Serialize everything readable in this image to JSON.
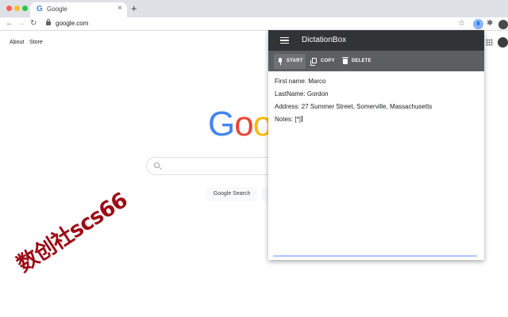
{
  "browser": {
    "tab_favicon": "G",
    "tab_title": "Google",
    "tab_close": "×",
    "new_tab": "+",
    "back": "←",
    "forward": "→",
    "reload": "↻",
    "url": "google.com",
    "star": "☆",
    "puzzle": "✱",
    "icons": [
      "back-icon",
      "forward-icon",
      "reload-icon",
      "lock-icon",
      "star-icon",
      "microphone-icon",
      "puzzle-icon",
      "avatar"
    ]
  },
  "google": {
    "about": "About",
    "store": "Store",
    "logo_letters": [
      "G",
      "o",
      "o",
      "g"
    ],
    "logo_colors": [
      "#4285f4",
      "#ea4335",
      "#fbbc05",
      "#4285f4"
    ],
    "search_button": "Google Search"
  },
  "popup": {
    "title": "DictationBox",
    "header_color": "#313436",
    "toolbar_color": "#5b5f62",
    "buttons": {
      "start": "START",
      "copy": "COPY",
      "delete": "DELETE"
    },
    "lines": {
      "first": "First name: Marco",
      "last": "LastName: Gordon",
      "address": "Address: 27 Summer Street, Somerville, Massachusetts",
      "notes": "Notes: [*]"
    }
  },
  "watermark": {
    "text": "数创社scs66",
    "color": "#9c0b16"
  }
}
